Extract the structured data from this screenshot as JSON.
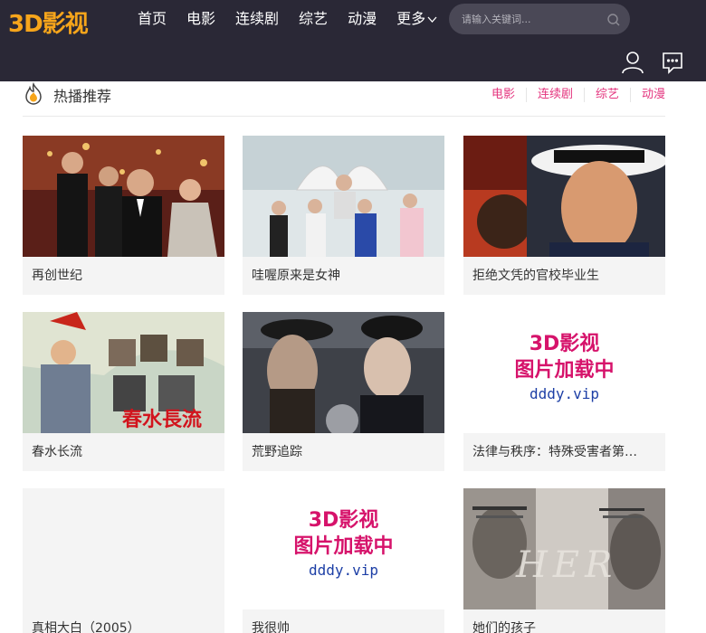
{
  "site": {
    "logo": "3D影视"
  },
  "nav": {
    "items": [
      "首页",
      "电影",
      "连续剧",
      "综艺",
      "动漫"
    ],
    "more": "更多"
  },
  "search": {
    "placeholder": "请输入关键词..."
  },
  "section": {
    "title": "热播推荐",
    "filters": [
      "电影",
      "连续剧",
      "综艺",
      "动漫"
    ]
  },
  "placeholder": {
    "line1": "3D影视",
    "line2": "图片加载中",
    "line3": "dddy.vip"
  },
  "cards": [
    {
      "title": "再创世纪"
    },
    {
      "title": "哇喔原来是女神"
    },
    {
      "title": "拒绝文凭的官校毕业生"
    },
    {
      "title": "春水长流",
      "poster_text": "春水長流"
    },
    {
      "title": "荒野追踪"
    },
    {
      "title": "法律与秩序：特殊受害者第二十四季"
    },
    {
      "title": "真相大白（2005）"
    },
    {
      "title": "我很帅"
    },
    {
      "title": "她们的孩子",
      "poster_text": "HER"
    }
  ],
  "colors": {
    "header_bg": "#2a2836",
    "logo": "#f6a51b",
    "accent": "#e4347e"
  }
}
